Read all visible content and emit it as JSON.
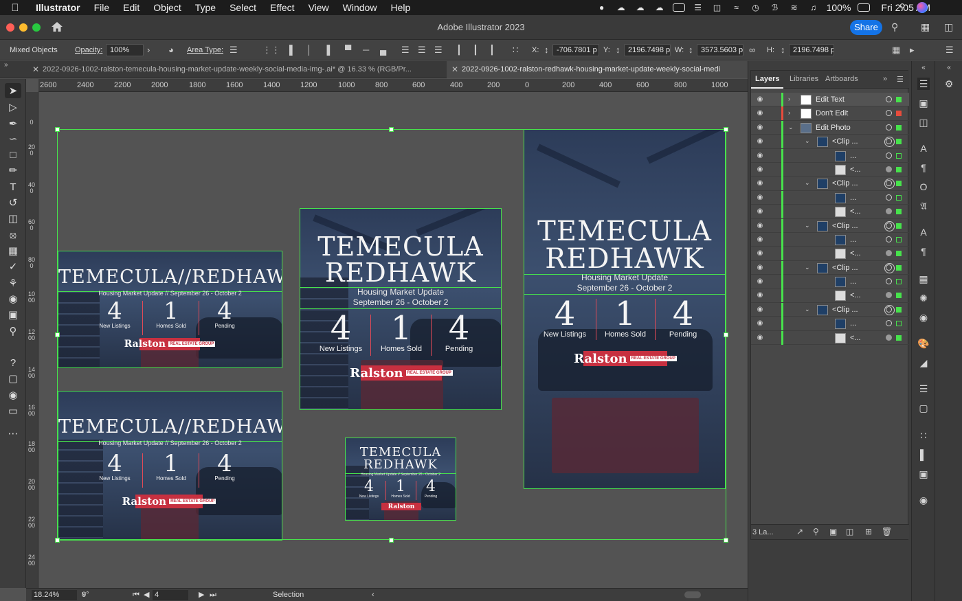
{
  "menubar": {
    "app_name": "Illustrator",
    "items": [
      "File",
      "Edit",
      "Object",
      "Type",
      "Select",
      "Effect",
      "View",
      "Window",
      "Help"
    ],
    "battery": "100%",
    "clock": "Fri 2:05 AM"
  },
  "titlebar": {
    "title": "Adobe Illustrator 2023",
    "share_label": "Share"
  },
  "controlbar": {
    "selection_type": "Mixed Objects",
    "opacity_label": "Opacity:",
    "opacity_value": "100%",
    "area_type_label": "Area Type:",
    "x_label": "X:",
    "x_value": "-706.7801 p",
    "y_label": "Y:",
    "y_value": "2196.7498 p",
    "w_label": "W:",
    "w_value": "3573.5603 p",
    "h_label": "H:",
    "h_value": "2196.7498 p"
  },
  "tabs": [
    {
      "label": "2022-0926-1002-ralston-temecula-housing-market-update-weekly-social-media-img-.ai* @ 16.33 % (RGB/Pr..."
    },
    {
      "label": "2022-0926-1002-ralston-redhawk-housing-market-update-weekly-social-medi"
    }
  ],
  "ruler": {
    "h_ticks": [
      "2600",
      "2400",
      "2200",
      "2000",
      "1800",
      "1600",
      "1400",
      "1200",
      "1000",
      "800",
      "600",
      "400",
      "200",
      "0",
      "200",
      "400",
      "600",
      "800",
      "1000"
    ],
    "v_ticks": [
      "0",
      "200",
      "400",
      "600",
      "800",
      "1000",
      "1200",
      "1400",
      "1600",
      "1800",
      "2000",
      "2200",
      "2400"
    ]
  },
  "artwork": {
    "title_line": "TEMECULA//REDHAWK",
    "title_line1": "TEMECULA",
    "title_line2": "REDHAWK",
    "subtitle_line": "Housing Market Update // September 26 - October 2",
    "subtitle_a": "Housing Market Update",
    "subtitle_b": "September 26 - October 2",
    "stat1_value": "4",
    "stat1_label": "New Listings",
    "stat2_value": "1",
    "stat2_label": "Homes Sold",
    "stat3_value": "4",
    "stat3_label": "Pending",
    "logo_text": "Ralston",
    "logo_tag": "REAL ESTATE GROUP"
  },
  "statusbar": {
    "zoom": "18.24%",
    "rotation": "0°",
    "artboard": "4",
    "mode": "Selection"
  },
  "layers_panel": {
    "tabs": [
      "Layers",
      "Libraries",
      "Artboards"
    ],
    "rows": [
      {
        "name": "Edit Text",
        "level": 0,
        "color": "#47e24c",
        "selected": true,
        "sel": "fill"
      },
      {
        "name": "Don't Edit",
        "level": 0,
        "color": "#e74c3c",
        "selected": false,
        "sel": "red"
      },
      {
        "name": "Edit Photo",
        "level": 0,
        "color": "#47e24c",
        "selected": false,
        "sel": "fill"
      },
      {
        "name": "<Clip ...",
        "level": 1,
        "color": "#47e24c",
        "sel": "fill"
      },
      {
        "name": "...",
        "level": 2,
        "color": "#47e24c",
        "sel": "hollow"
      },
      {
        "name": "<...",
        "level": 2,
        "color": "#47e24c",
        "sel": "fill"
      },
      {
        "name": "<Clip ...",
        "level": 1,
        "color": "#47e24c",
        "sel": "fill"
      },
      {
        "name": "...",
        "level": 2,
        "color": "#47e24c",
        "sel": "hollow"
      },
      {
        "name": "<...",
        "level": 2,
        "color": "#47e24c",
        "sel": "fill"
      },
      {
        "name": "<Clip ...",
        "level": 1,
        "color": "#47e24c",
        "sel": "fill"
      },
      {
        "name": "...",
        "level": 2,
        "color": "#47e24c",
        "sel": "hollow"
      },
      {
        "name": "<...",
        "level": 2,
        "color": "#47e24c",
        "sel": "fill"
      },
      {
        "name": "<Clip ...",
        "level": 1,
        "color": "#47e24c",
        "sel": "fill"
      },
      {
        "name": "...",
        "level": 2,
        "color": "#47e24c",
        "sel": "hollow"
      },
      {
        "name": "<...",
        "level": 2,
        "color": "#47e24c",
        "sel": "fill"
      },
      {
        "name": "<Clip ...",
        "level": 1,
        "color": "#47e24c",
        "sel": "fill"
      },
      {
        "name": "...",
        "level": 2,
        "color": "#47e24c",
        "sel": "hollow"
      },
      {
        "name": "<...",
        "level": 2,
        "color": "#47e24c",
        "sel": "fill"
      }
    ],
    "layer_count": "3 La..."
  },
  "colors": {
    "selection_green": "#47e24c",
    "accent_blue": "#1473e6",
    "brand_red": "#c73040"
  }
}
